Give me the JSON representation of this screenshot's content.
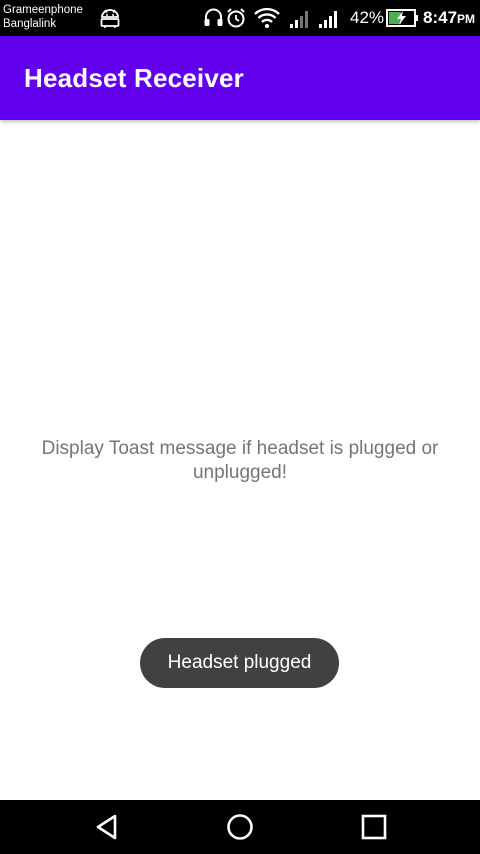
{
  "status_bar": {
    "carrier_1": "Grameenphone",
    "carrier_2": "Banglalink",
    "battery_percent": "42%",
    "time": "8:47",
    "ampm": "PM",
    "icons": [
      "android-debug-icon",
      "headset-icon",
      "alarm-icon",
      "wifi-icon",
      "signal-icon",
      "signal-icon",
      "battery-charging-icon"
    ]
  },
  "app_bar": {
    "title": "Headset Receiver",
    "color": "#6200ee"
  },
  "main": {
    "message": "Display Toast message if headset is plugged or unplugged!"
  },
  "toast": {
    "text": "Headset plugged"
  },
  "nav_bar": {
    "buttons": [
      "back-icon",
      "home-icon",
      "recents-icon"
    ]
  }
}
